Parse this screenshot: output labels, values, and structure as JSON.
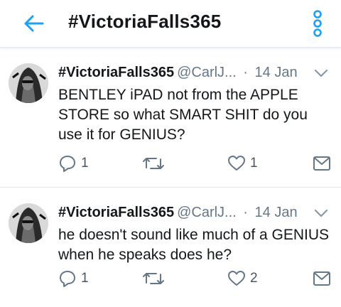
{
  "header": {
    "title": "#VictoriaFalls365"
  },
  "tweets": [
    {
      "name": "#VictoriaFalls365",
      "handle": "@CarlJ...",
      "separator": "·",
      "date": "14 Jan",
      "text": "BENTLEY iPAD not from the APPLE STORE so what SMART SHIT do you use it for GENIUS?",
      "replies": "1",
      "likes": "1"
    },
    {
      "name": "#VictoriaFalls365",
      "handle": "@CarlJ...",
      "separator": "·",
      "date": "14 Jan",
      "text": "he doesn't sound like much of a GENIUS when he speaks does he?",
      "replies": "1",
      "likes": "2"
    }
  ],
  "icons": {
    "back": "arrow-left-icon",
    "more": "more-vertical-icon",
    "caret": "chevron-down-icon",
    "reply": "reply-icon",
    "retweet": "retweet-icon",
    "like": "heart-icon",
    "message": "envelope-icon"
  },
  "colors": {
    "accent": "#1da1f2",
    "text": "#14171a",
    "muted": "#657786",
    "divider": "#e1e8ed"
  }
}
